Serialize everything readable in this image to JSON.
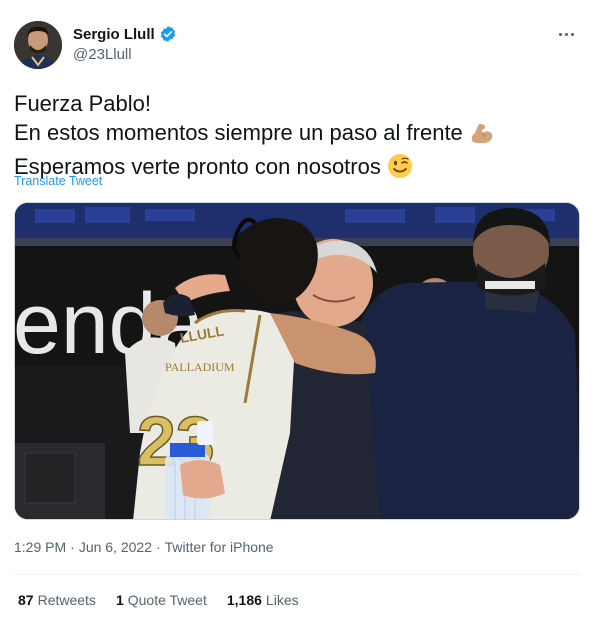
{
  "author": {
    "display_name": "Sergio Llull",
    "handle": "@23Llull",
    "verified": true
  },
  "tweet": {
    "lines": [
      "Fuerza Pablo!",
      "En estos momentos siempre un paso al frente",
      "Esperamos verte pronto con nosotros"
    ],
    "emojis": [
      "flexed-biceps-icon",
      "winking-face-icon"
    ],
    "translate_label": "Translate Tweet"
  },
  "media": {
    "shirt_text": "LLULL",
    "shirt_number": "23",
    "sponsor_text": "PALLADIUM",
    "background_text": "enda"
  },
  "meta": {
    "time": "1:29 PM",
    "date": "Jun 6, 2022",
    "source": "Twitter for iPhone",
    "separator": "·"
  },
  "stats": {
    "retweets_count": "87",
    "retweets_label": "Retweets",
    "quotes_count": "1",
    "quotes_label": "Quote Tweet",
    "likes_count": "1,186",
    "likes_label": "Likes"
  },
  "colors": {
    "text_primary": "#0f1419",
    "text_secondary": "#536471",
    "link": "#1d9bf0",
    "divider": "#eff3f4"
  }
}
